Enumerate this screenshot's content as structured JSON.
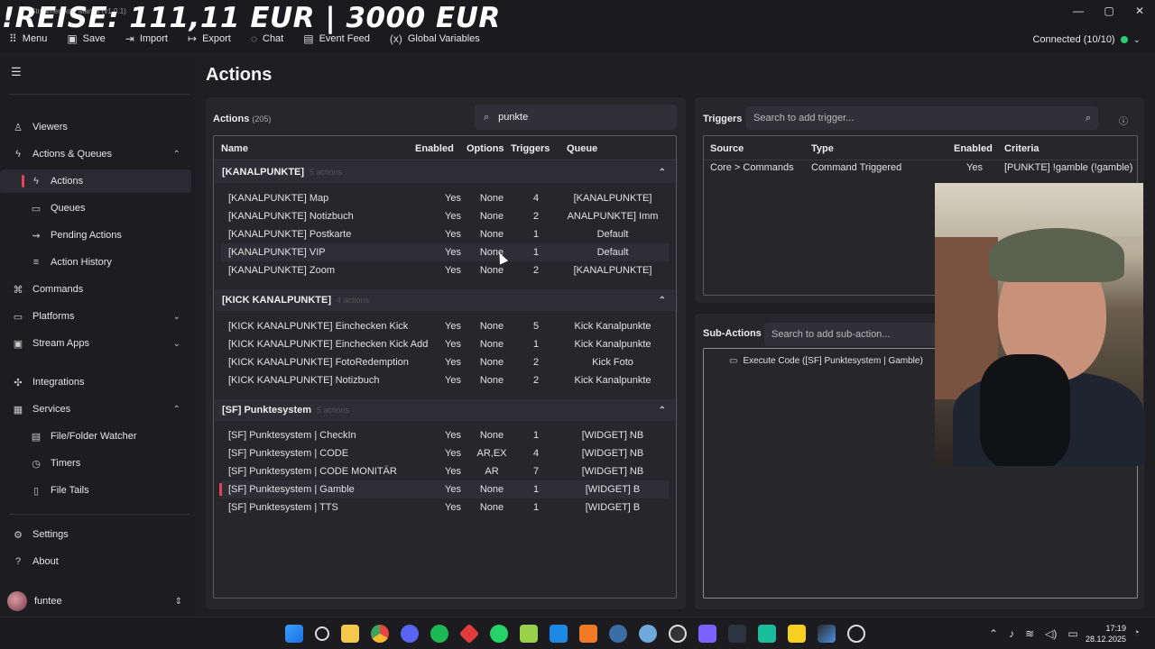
{
  "overlay_title": "!REISE: 111,11 EUR | 3000 EUR",
  "window_title": "Streamer.bot - Mantis (v1.0.1)",
  "window_controls": [
    "—",
    "▢",
    "✕"
  ],
  "toolbar": [
    {
      "icon": "grid-icon",
      "label": "Menu"
    },
    {
      "icon": "save-icon",
      "label": "Save"
    },
    {
      "icon": "import-icon",
      "label": "Import"
    },
    {
      "icon": "export-icon",
      "label": "Export"
    },
    {
      "icon": "chat-icon",
      "label": "Chat"
    },
    {
      "icon": "event-feed-icon",
      "label": "Event Feed"
    },
    {
      "icon": "variables-icon",
      "label": "Global Variables"
    }
  ],
  "connection": {
    "label": "Connected (10/10)",
    "status_color": "#2ecc71"
  },
  "sidebar": {
    "items": [
      {
        "label": "Viewers",
        "icon": "viewers-icon"
      },
      {
        "label": "Actions & Queues",
        "icon": "actions-icon"
      },
      {
        "label": "Actions",
        "icon": "action-icon"
      },
      {
        "label": "Queues",
        "icon": "queue-icon"
      },
      {
        "label": "Pending Actions",
        "icon": "pending-icon"
      },
      {
        "label": "Action History",
        "icon": "history-icon"
      },
      {
        "label": "Commands",
        "icon": "command-icon"
      },
      {
        "label": "Platforms",
        "icon": "platforms-icon"
      },
      {
        "label": "Stream Apps",
        "icon": "stream-apps-icon"
      },
      {
        "label": "Integrations",
        "icon": "integrations-icon"
      },
      {
        "label": "Services",
        "icon": "services-icon"
      },
      {
        "label": "File/Folder Watcher",
        "icon": "folder-watch-icon"
      },
      {
        "label": "Timers",
        "icon": "timer-icon"
      },
      {
        "label": "File Tails",
        "icon": "file-tail-icon"
      },
      {
        "label": "Settings",
        "icon": "settings-icon"
      },
      {
        "label": "About",
        "icon": "about-icon"
      }
    ],
    "user": "funtee"
  },
  "main": {
    "title": "Actions",
    "actions_label": "Actions",
    "actions_count": "(205)",
    "search_value": "punkte",
    "columns": [
      "Name",
      "Enabled",
      "Options",
      "Triggers",
      "Queue"
    ],
    "groups": [
      {
        "name": "[KANALPUNKTE]",
        "count": "5 actions",
        "rows": [
          [
            "[KANALPUNKTE] Map",
            "Yes",
            "None",
            "4",
            "[KANALPUNKTE]"
          ],
          [
            "[KANALPUNKTE] Notizbuch",
            "Yes",
            "None",
            "2",
            "ANALPUNKTE] Imm"
          ],
          [
            "[KANALPUNKTE] Postkarte",
            "Yes",
            "None",
            "1",
            "Default"
          ],
          [
            "[KANALPUNKTE] VIP",
            "Yes",
            "None",
            "1",
            "Default"
          ],
          [
            "[KANALPUNKTE] Zoom",
            "Yes",
            "None",
            "2",
            "[KANALPUNKTE]"
          ]
        ]
      },
      {
        "name": "[KICK KANALPUNKTE]",
        "count": "4 actions",
        "rows": [
          [
            "[KICK KANALPUNKTE] Einchecken Kick",
            "Yes",
            "None",
            "5",
            "Kick Kanalpunkte"
          ],
          [
            "[KICK KANALPUNKTE] Einchecken Kick Add",
            "Yes",
            "None",
            "1",
            "Kick Kanalpunkte"
          ],
          [
            "[KICK KANALPUNKTE] FotoRedemption",
            "Yes",
            "None",
            "2",
            "Kick Foto"
          ],
          [
            "[KICK KANALPUNKTE] Notizbuch",
            "Yes",
            "None",
            "2",
            "Kick Kanalpunkte"
          ]
        ]
      },
      {
        "name": "[SF] Punktesystem",
        "count": "5 actions",
        "rows": [
          [
            "[SF] Punktesystem | CheckIn",
            "Yes",
            "None",
            "1",
            "[WIDGET] NB"
          ],
          [
            "[SF] Punktesystem | CODE",
            "Yes",
            "AR,EX",
            "4",
            "[WIDGET] NB"
          ],
          [
            "[SF] Punktesystem | CODE MONITÄR",
            "Yes",
            "AR",
            "7",
            "[WIDGET] NB"
          ],
          [
            "[SF] Punktesystem | Gamble",
            "Yes",
            "None",
            "1",
            "[WIDGET] B"
          ],
          [
            "[SF] Punktesystem | TTS",
            "Yes",
            "None",
            "1",
            "[WIDGET] B"
          ]
        ]
      }
    ]
  },
  "triggers": {
    "title": "Triggers",
    "search_placeholder": "Search to add trigger...",
    "columns": [
      "Source",
      "Type",
      "Enabled",
      "Criteria"
    ],
    "rows": [
      [
        "Core > Commands",
        "Command Triggered",
        "Yes",
        "[PUNKTE] !gamble (!gamble)"
      ]
    ]
  },
  "sub_actions": {
    "title": "Sub-Actions",
    "search_placeholder": "Search to add sub-action...",
    "items": [
      "Execute Code ([SF] Punktesystem | Gamble)"
    ]
  },
  "taskbar": {
    "time": "17:19",
    "date": "28.12.2025"
  },
  "colors": {
    "accent": "#e0445a",
    "bg": "#1f1f23",
    "panel": "#26262b"
  }
}
